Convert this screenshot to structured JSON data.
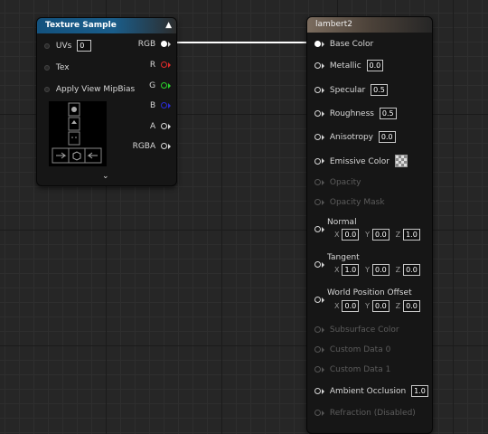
{
  "texture_sample": {
    "title": "Texture Sample",
    "inputs": {
      "uvs_label": "UVs",
      "uvs_value": "0",
      "tex_label": "Tex",
      "mipbias_label": "Apply View MipBias"
    },
    "outputs": {
      "rgb": "RGB",
      "r": "R",
      "g": "G",
      "b": "B",
      "a": "A",
      "rgba": "RGBA"
    }
  },
  "lambert": {
    "title": "lambert2",
    "base_color": "Base Color",
    "metallic": {
      "label": "Metallic",
      "value": "0.0"
    },
    "specular": {
      "label": "Specular",
      "value": "0.5"
    },
    "roughness": {
      "label": "Roughness",
      "value": "0.5"
    },
    "anisotropy": {
      "label": "Anisotropy",
      "value": "0.0"
    },
    "emissive": "Emissive Color",
    "opacity": "Opacity",
    "opacity_mask": "Opacity Mask",
    "normal": {
      "label": "Normal",
      "x": "0.0",
      "y": "0.0",
      "z": "1.0"
    },
    "tangent": {
      "label": "Tangent",
      "x": "1.0",
      "y": "0.0",
      "z": "0.0"
    },
    "wpo": {
      "label": "World Position Offset",
      "x": "0.0",
      "y": "0.0",
      "z": "0.0"
    },
    "subsurface": "Subsurface Color",
    "custom0": "Custom Data 0",
    "custom1": "Custom Data 1",
    "ao": {
      "label": "Ambient Occlusion",
      "value": "1.0"
    },
    "refraction": "Refraction (Disabled)",
    "axis_x": "X",
    "axis_y": "Y",
    "axis_z": "Z"
  },
  "colors": {
    "pin_r": "#e02b2b",
    "pin_g": "#2bd42b",
    "pin_b": "#2b2bd4",
    "texture_header": "#13527e",
    "material_header": "#7b6c5e"
  },
  "icons": [
    "collapse-up-icon",
    "expand-down-icon",
    "pin-icon",
    "checker-icon"
  ]
}
